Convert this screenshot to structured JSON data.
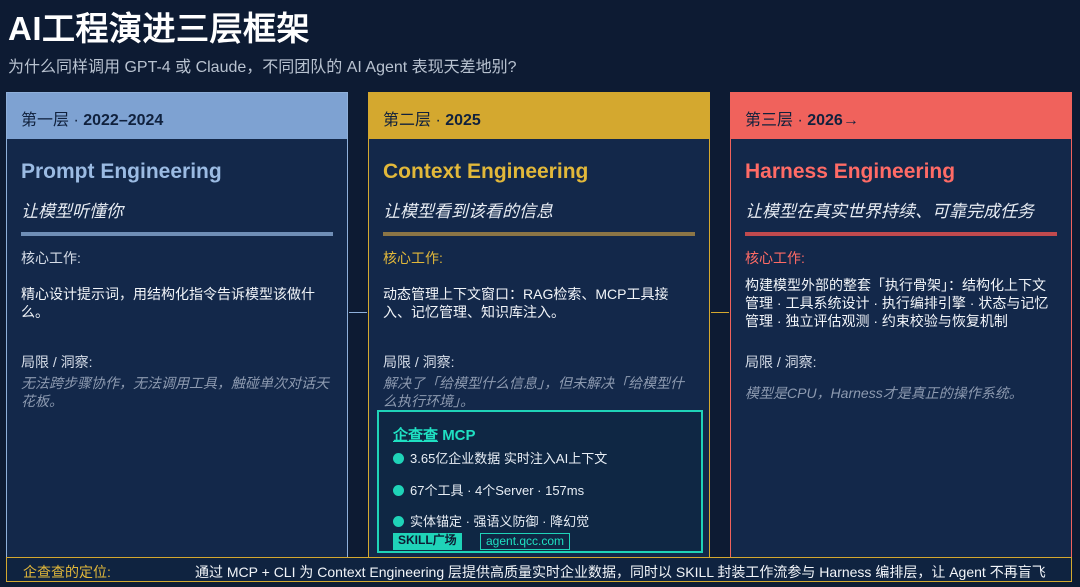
{
  "header": {
    "title": "AI工程演进三层框架",
    "subtitle": "为什么同样调用 GPT-4 或 Claude，不同团队的 AI Agent 表现天差地别?"
  },
  "layers": [
    {
      "layer": "第一层 ·",
      "period": "2022–2024",
      "name": "Prompt Engineering",
      "tagline": "让模型听懂你",
      "work_label": "核心工作:",
      "work": "精心设计提示词，用结构化指令告诉模型该做什么。",
      "limit_label": "局限 / 洞察:",
      "limit": "无法跨步骤协作，无法调用工具，触碰单次对话天花板。",
      "color": "#7ea2d2"
    },
    {
      "layer": "第二层 ·",
      "period": "2025",
      "name": "Context Engineering",
      "tagline": "让模型看到该看的信息",
      "work_label": "核心工作:",
      "work": "动态管理上下文窗口：RAG检索、MCP工具接入、记忆管理、知识库注入。",
      "limit_label": "局限 / 洞察:",
      "limit": "解决了「给模型什么信息」，但未解决「给模型什么执行环境」。",
      "color": "#d4a82f"
    },
    {
      "layer": "第三层 ·",
      "period": "2026→",
      "name": "Harness Engineering",
      "tagline": "让模型在真实世界持续、可靠完成任务",
      "work_label": "核心工作:",
      "work": "构建模型外部的整套「执行骨架」：结构化上下文管理 · 工具系统设计 · 执行编排引擎 · 状态与记忆管理 · 独立评估观测 · 约束校验与恢复机制",
      "limit_label": "局限 / 洞察:",
      "limit": "模型是CPU，Harness才是真正的操作系统。",
      "color": "#f0625c"
    }
  ],
  "mcp_box": {
    "brand": "企查查",
    "title": "MCP",
    "items": [
      "3.65亿企业数据 实时注入AI上下文",
      "67个工具 · 4个Server · 157ms",
      "实体锚定 · 强语义防御 · 降幻觉"
    ],
    "tag_skill": "SKILL广场",
    "tag_url": "agent.qcc.com",
    "color": "#1fd3b8"
  },
  "footer": {
    "label": "企查查的定位:",
    "text": "通过 MCP + CLI 为 Context Engineering 层提供高质量实时企业数据，同时以 SKILL 封装工作流参与 Harness 编排层，让 Agent 不再盲飞"
  }
}
